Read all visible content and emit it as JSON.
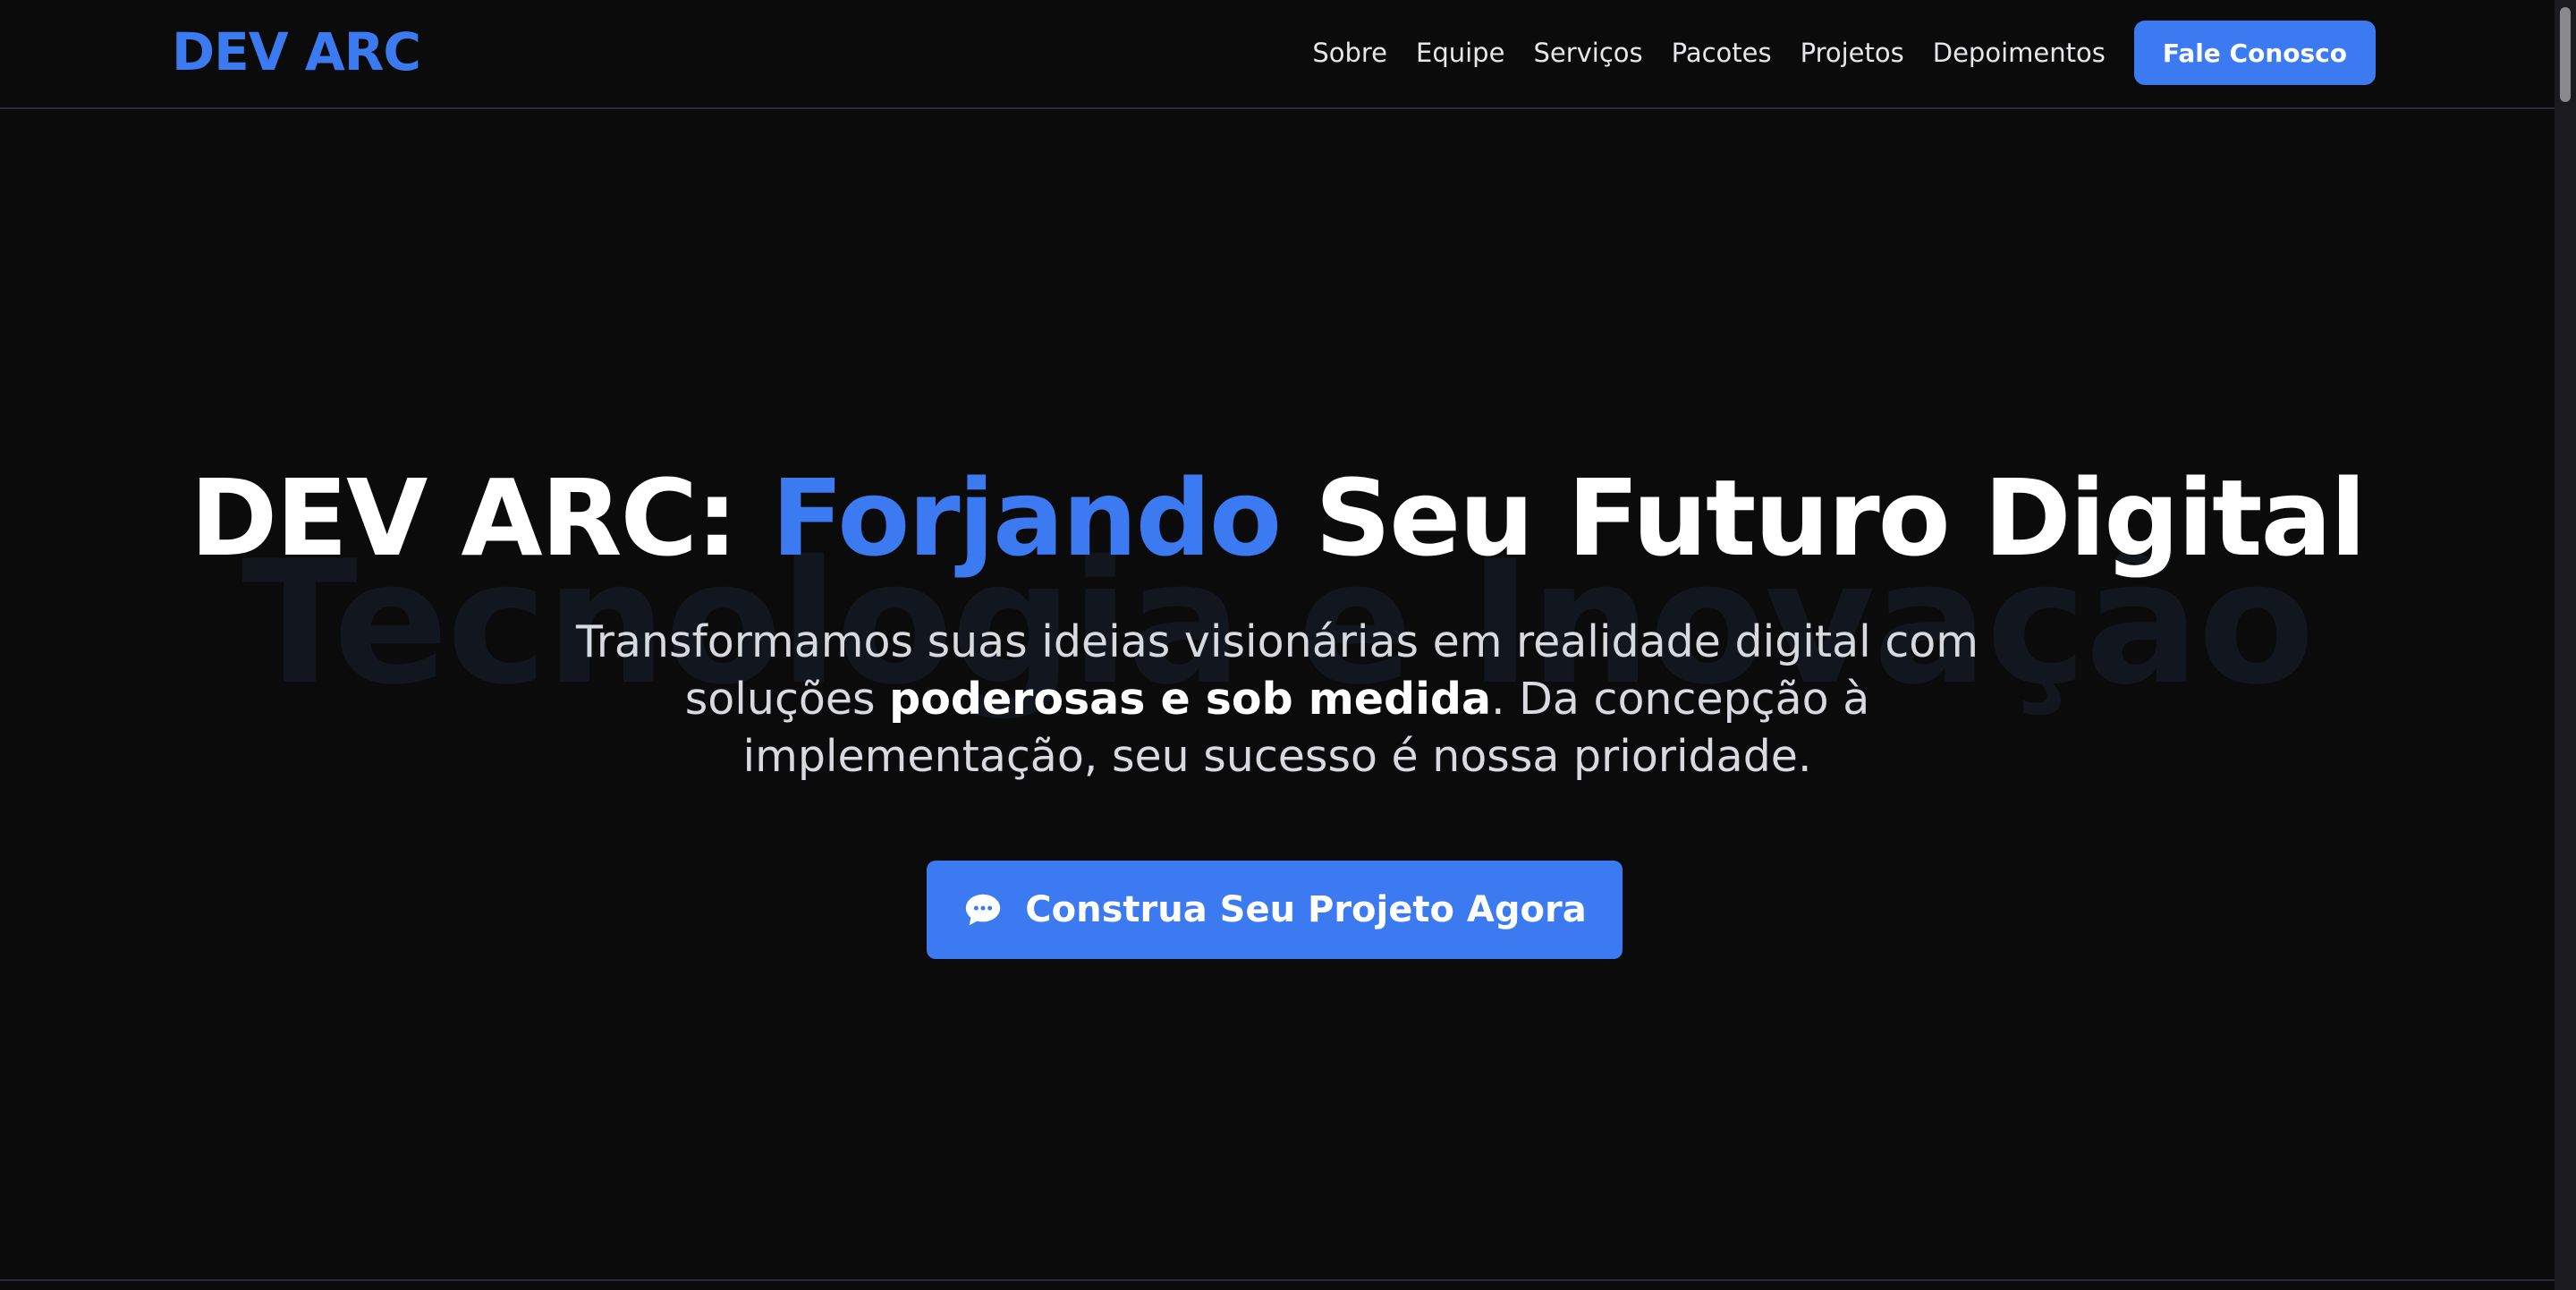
{
  "header": {
    "logo": "DEV ARC",
    "nav": [
      {
        "label": "Sobre"
      },
      {
        "label": "Equipe"
      },
      {
        "label": "Serviços"
      },
      {
        "label": "Pacotes"
      },
      {
        "label": "Projetos"
      },
      {
        "label": "Depoimentos"
      }
    ],
    "cta_label": "Fale Conosco"
  },
  "hero": {
    "background_word": "Tecnologia e Inovação",
    "title_prefix": "DEV ARC: ",
    "title_accent": "Forjando",
    "title_suffix": " Seu Futuro Digital",
    "subtitle_part1": "Transformamos suas ideias visionárias em realidade digital com soluções ",
    "subtitle_strong": "poderosas e sob medida",
    "subtitle_part2": ". Da concepção à implementação, seu sucesso é nossa prioridade.",
    "cta_label": "Construa Seu Projeto Agora",
    "cta_icon": "chat-bubble-icon"
  },
  "colors": {
    "accent": "#3b7af1",
    "background": "#0b0b0c",
    "text": "#ffffff"
  }
}
